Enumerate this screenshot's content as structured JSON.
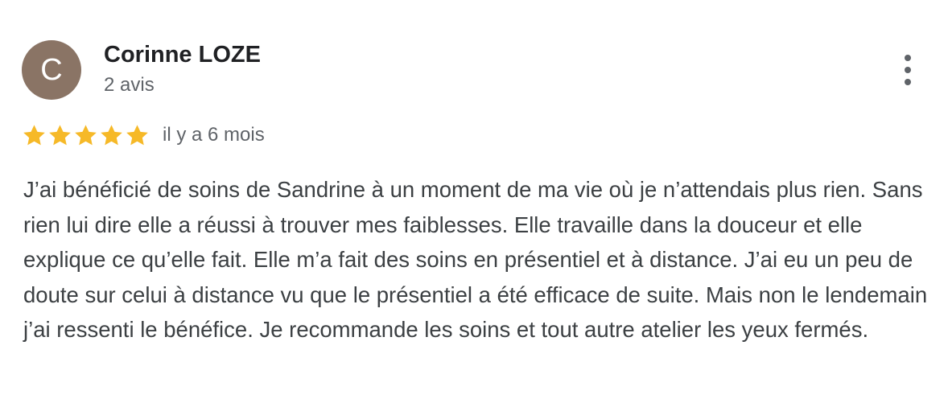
{
  "review": {
    "avatar_letter": "C",
    "avatar_color": "#8a7465",
    "author_name": "Corinne LOZE",
    "author_reviews": "2 avis",
    "rating": 5,
    "rating_max": 5,
    "star_color": "#f6b928",
    "date": "il y a 6 mois",
    "text": "J’ai bénéficié de soins de Sandrine à un moment de ma vie où je n’attendais plus rien. Sans rien lui dire elle a réussi à trouver mes faiblesses. Elle travaille dans la douceur et elle explique ce qu’elle fait. Elle m’a fait des soins en présentiel et à distance. J’ai eu un peu de doute sur celui à distance vu que le présentiel a été efficace de suite. Mais non le lendemain j’ai ressenti le bénéfice. Je recommande les soins et tout autre atelier les yeux fermés.",
    "menu_icon": "more-vert-icon"
  }
}
